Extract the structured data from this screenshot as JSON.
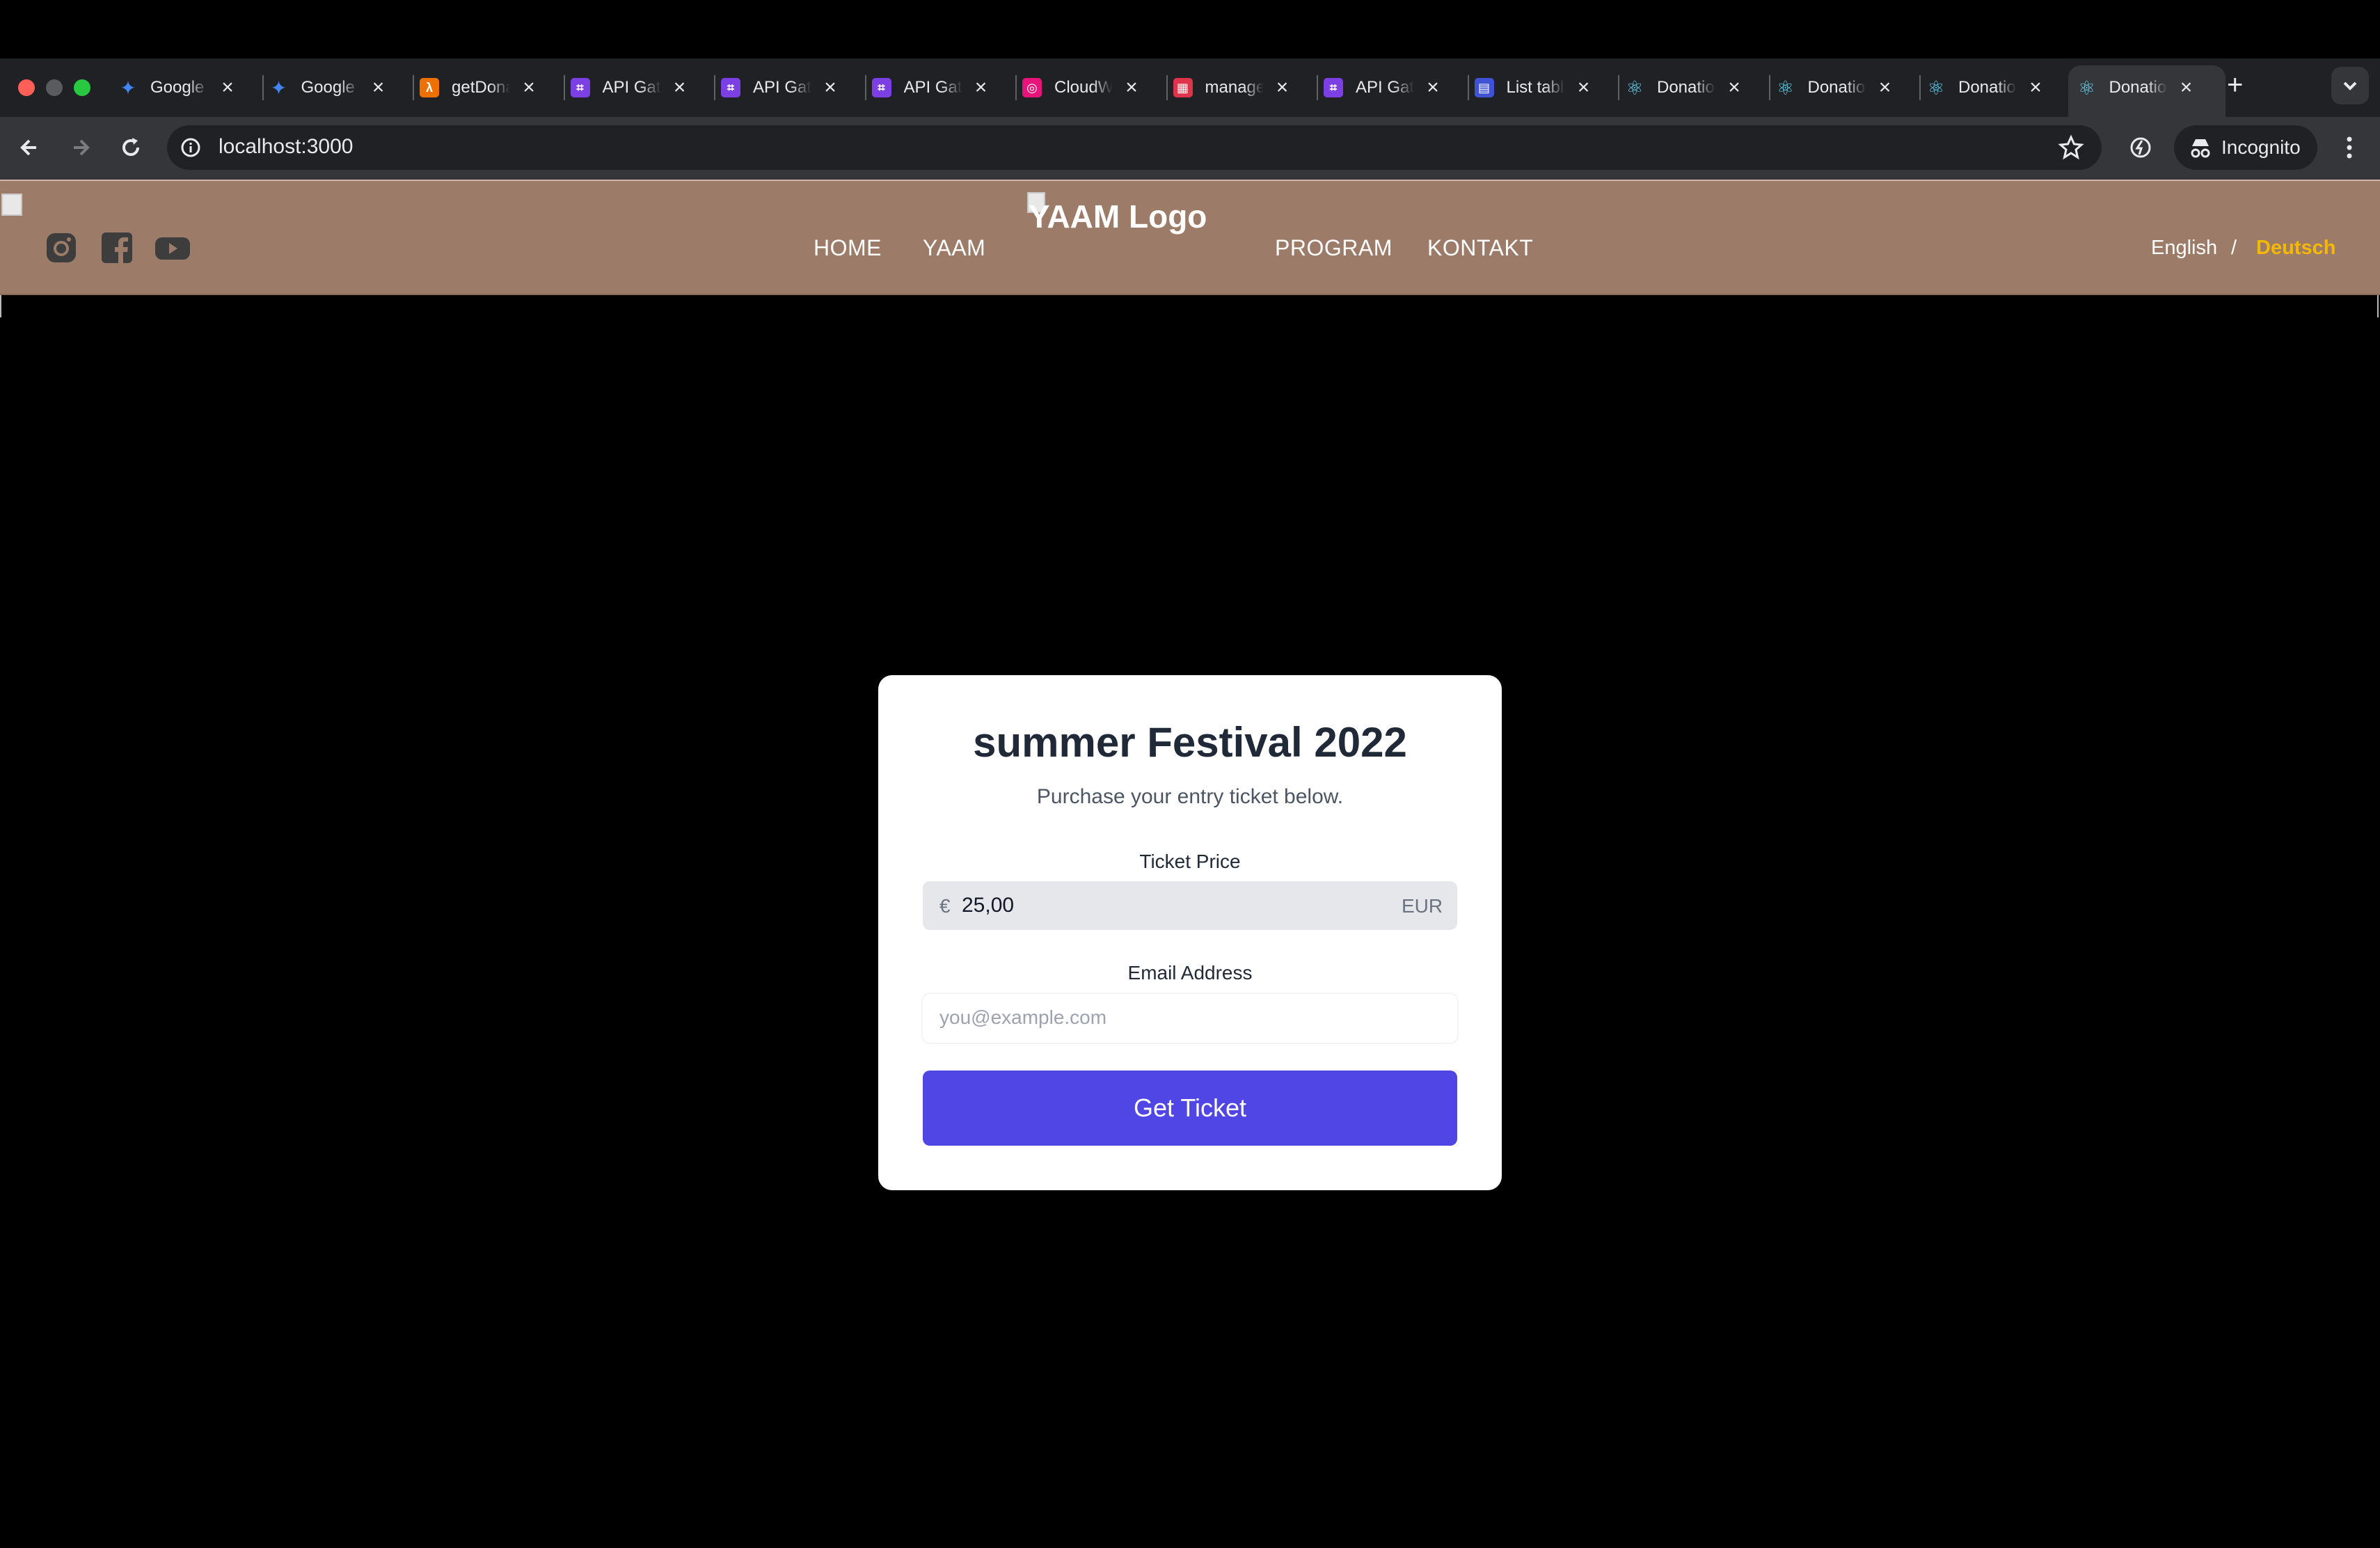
{
  "browser": {
    "tabs": [
      {
        "title": "Google",
        "favicon": "gemini-sparkle-icon",
        "color": "#4285f4"
      },
      {
        "title": "Google",
        "favicon": "gemini-sparkle-icon",
        "color": "#4285f4"
      },
      {
        "title": "getDonation",
        "favicon": "aws-lambda-icon",
        "color": "#ed7100"
      },
      {
        "title": "API Gateway",
        "favicon": "api-gateway-icon",
        "color": "#7b3fe4"
      },
      {
        "title": "API Gateway",
        "favicon": "api-gateway-icon",
        "color": "#7b3fe4"
      },
      {
        "title": "API Gateway",
        "favicon": "api-gateway-icon",
        "color": "#7b3fe4"
      },
      {
        "title": "CloudWatch",
        "favicon": "cloudwatch-icon",
        "color": "#e7157b"
      },
      {
        "title": "manage",
        "favicon": "management-icon",
        "color": "#dd344c"
      },
      {
        "title": "API Gateway",
        "favicon": "api-gateway-icon",
        "color": "#7b3fe4"
      },
      {
        "title": "List tables",
        "favicon": "dynamodb-icon",
        "color": "#4053d6"
      },
      {
        "title": "Donation",
        "favicon": "react-icon",
        "color": "#61dafb"
      },
      {
        "title": "Donation",
        "favicon": "react-icon",
        "color": "#61dafb"
      },
      {
        "title": "Donation",
        "favicon": "react-icon",
        "color": "#61dafb"
      },
      {
        "title": "Donation",
        "favicon": "react-icon",
        "color": "#61dafb",
        "active": true
      }
    ],
    "url": "localhost:3000",
    "incognito_label": "Incognito"
  },
  "site": {
    "logo_alt": "YAAM Logo",
    "nav": [
      "HOME",
      "YAAM",
      "PROGRAM",
      "KONTAKT"
    ],
    "social": [
      "instagram-icon",
      "facebook-icon",
      "youtube-icon"
    ],
    "lang_english": "English",
    "lang_separator": "/",
    "lang_deutsch": "Deutsch",
    "header_color": "#9c7b69",
    "active_lang_color": "#f5b800"
  },
  "ticket": {
    "title": "summer Festival 2022",
    "subtitle": "Purchase your entry ticket below.",
    "price_label": "Ticket Price",
    "currency_symbol": "€",
    "price_value": "25,00",
    "currency_code": "EUR",
    "email_label": "Email Address",
    "email_placeholder": "you@example.com",
    "button_label": "Get Ticket",
    "button_color": "#4f46e5"
  }
}
